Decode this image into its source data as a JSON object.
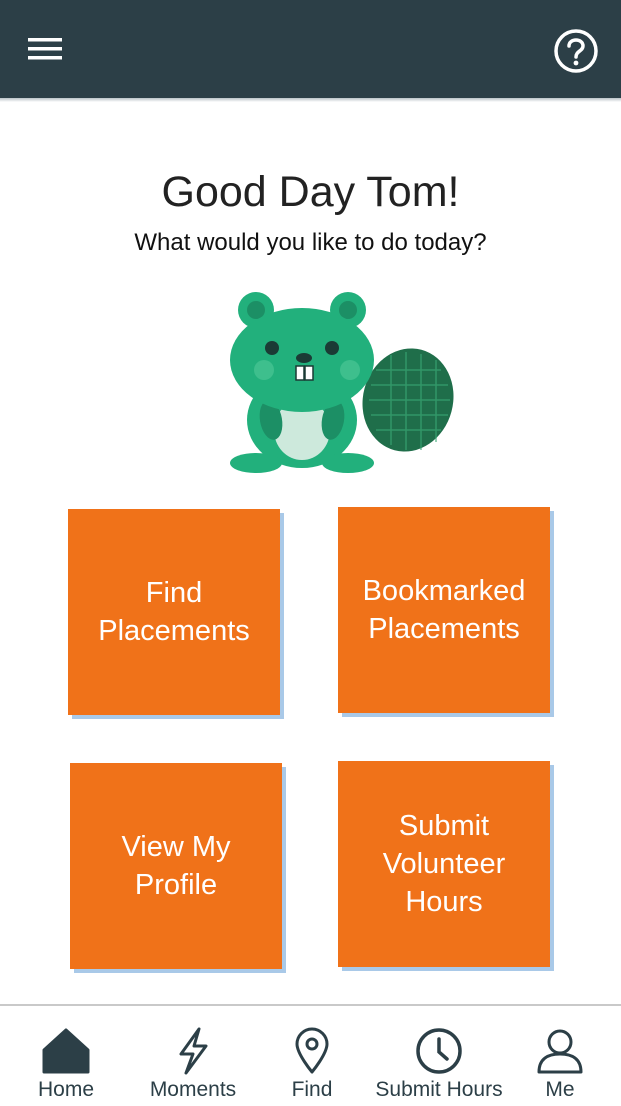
{
  "header": {
    "menu_icon": "hamburger-menu-icon",
    "help_icon": "help-question-icon",
    "bar_color": "#2c3f47"
  },
  "main": {
    "greeting": "Good Day Tom!",
    "subtitle": "What would you like to do today?",
    "mascot": "beaver-mascot",
    "tile_color": "#f07219",
    "tiles": [
      {
        "label": "Find\nPlacements"
      },
      {
        "label": "Bookmarked\nPlacements"
      },
      {
        "label": "View My\nProfile"
      },
      {
        "label": "Submit\nVolunteer\nHours"
      }
    ]
  },
  "bottom_nav": {
    "items": [
      {
        "label": "Home",
        "icon": "home-icon"
      },
      {
        "label": "Moments",
        "icon": "lightning-icon"
      },
      {
        "label": "Find",
        "icon": "location-pin-icon"
      },
      {
        "label": "Submit Hours",
        "icon": "clock-icon"
      },
      {
        "label": "Me",
        "icon": "person-icon"
      }
    ]
  }
}
